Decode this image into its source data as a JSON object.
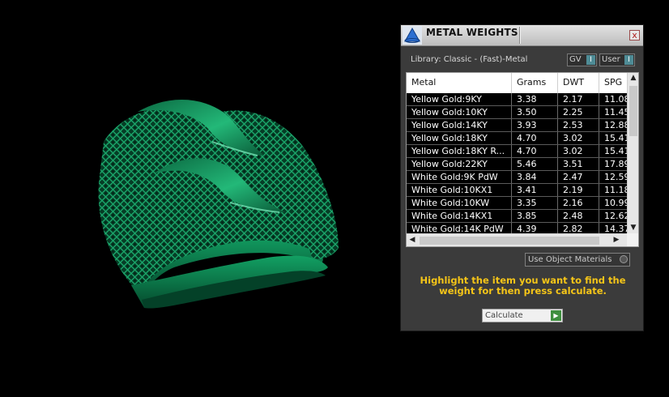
{
  "panel": {
    "title": "METAL WEIGHTS",
    "close_glyph": "x",
    "library_label": "Library: Classic - (Fast)-Metal",
    "toggles": [
      {
        "label": "GV",
        "knob": "I"
      },
      {
        "label": "User",
        "knob": "I"
      }
    ],
    "table": {
      "columns": [
        "Metal",
        "Grams",
        "DWT",
        "SPG"
      ],
      "rows": [
        [
          "Yellow Gold:9KY",
          "3.38",
          "2.17",
          "11.08"
        ],
        [
          "Yellow Gold:10KY",
          "3.50",
          "2.25",
          "11.45"
        ],
        [
          "Yellow Gold:14KY",
          "3.93",
          "2.53",
          "12.88"
        ],
        [
          "Yellow Gold:18KY",
          "4.70",
          "3.02",
          "15.41"
        ],
        [
          "Yellow Gold:18KY R...",
          "4.70",
          "3.02",
          "15.41"
        ],
        [
          "Yellow Gold:22KY",
          "5.46",
          "3.51",
          "17.89"
        ],
        [
          "White Gold:9K PdW",
          "3.84",
          "2.47",
          "12.59"
        ],
        [
          "White Gold:10KX1",
          "3.41",
          "2.19",
          "11.18"
        ],
        [
          "White Gold:10KW",
          "3.35",
          "2.16",
          "10.99"
        ],
        [
          "White Gold:14KX1",
          "3.85",
          "2.48",
          "12.62"
        ],
        [
          "White Gold:14K PdW",
          "4.39",
          "2.82",
          "14.37"
        ]
      ]
    },
    "use_object_materials": "Use Object Materials",
    "hint": "Highlight the item you want to find the weight for then press calculate.",
    "calculate": "Calculate"
  },
  "icons": {
    "app": "triangle-logo-icon",
    "close": "close-icon",
    "scroll_up": "chevron-up-icon",
    "scroll_down": "chevron-down-icon",
    "scroll_left": "chevron-left-icon",
    "scroll_right": "chevron-right-icon"
  },
  "colors": {
    "ring": "#0a7a4a",
    "hint": "#f5c518",
    "toggle_knob": "#4f8c96"
  }
}
